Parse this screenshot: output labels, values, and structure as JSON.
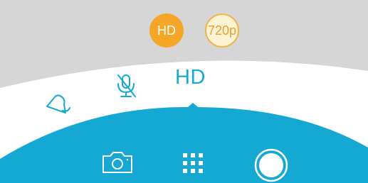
{
  "resolution": {
    "options": [
      "HD",
      "720p"
    ],
    "selected": "HD"
  },
  "mode_row": {
    "items": [
      {
        "icon": "bell-icon"
      },
      {
        "icon": "mic-off-icon"
      },
      {
        "label": "HD"
      }
    ]
  },
  "bottom_bar": {
    "items": [
      {
        "icon": "camera-icon"
      },
      {
        "icon": "grid-icon"
      },
      {
        "icon": "shutter-record-icon"
      }
    ]
  },
  "colors": {
    "accent": "#14a8d2",
    "selected_chip": "#f5a627",
    "unselected_chip_bg": "#fff3d6",
    "top_panel": "#d6d6d6"
  }
}
